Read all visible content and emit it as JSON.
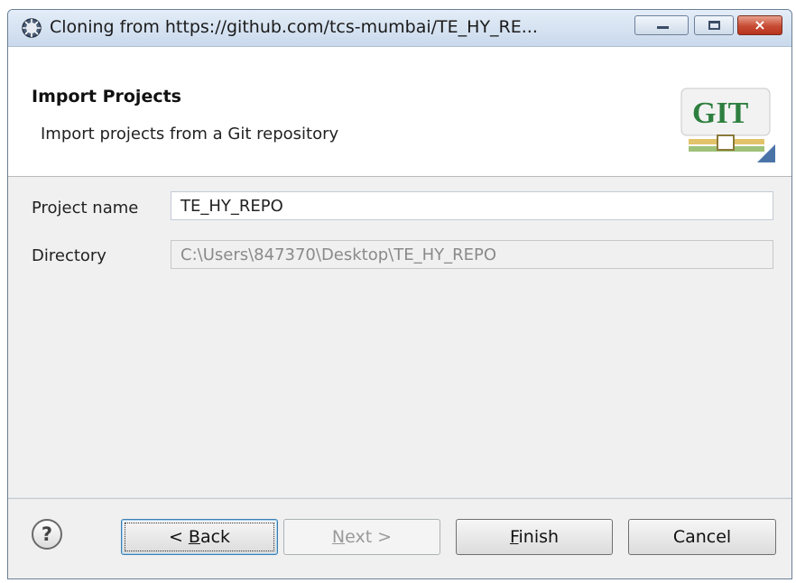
{
  "window": {
    "title": "Cloning from https://github.com/tcs-mumbai/TE_HY_RE...",
    "close_glyph": "×"
  },
  "header": {
    "title": "Import Projects",
    "subtitle": "Import projects from a Git repository",
    "logo_text": "GIT"
  },
  "form": {
    "project_name_label": "Project name",
    "project_name_value": "TE_HY_REPO",
    "directory_label": "Directory",
    "directory_value": "C:\\Users\\847370\\Desktop\\TE_HY_REPO"
  },
  "footer": {
    "help_glyph": "?",
    "back": {
      "prefix": "< ",
      "accel": "B",
      "rest": "ack"
    },
    "next": {
      "accel": "N",
      "rest": "ext >"
    },
    "finish": {
      "accel": "F",
      "rest": "inish"
    },
    "cancel_label": "Cancel"
  }
}
